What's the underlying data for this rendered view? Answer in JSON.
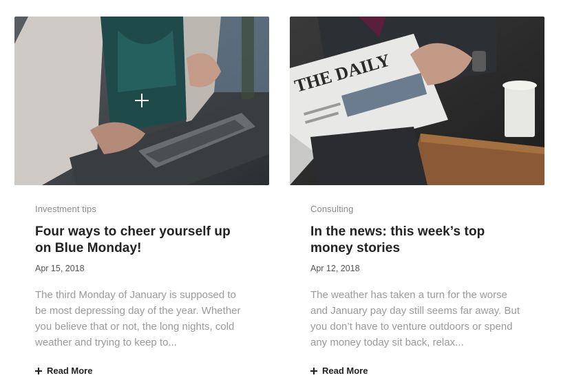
{
  "posts": [
    {
      "image_icon": "laptop-photo",
      "category": "Investment tips",
      "title": "Four ways to cheer yourself up on Blue Monday!",
      "date": "Apr 15, 2018",
      "excerpt": "The third Monday of January is supposed to be most depressing day of the year. Whether you believe that or not, the long nights, cold weather and trying to keep to...",
      "read_more": "Read More"
    },
    {
      "image_icon": "newspaper-photo",
      "category": "Consulting",
      "title": "In the news: this week’s top money stories",
      "date": "Apr 12, 2018",
      "excerpt": "The weather has taken a turn for the worse and January pay day still seems far away. But you don’t have to venture outdoors or spend any money today sit back, relax...",
      "read_more": "Read More",
      "newspaper_masthead": "THE DAILY"
    }
  ]
}
